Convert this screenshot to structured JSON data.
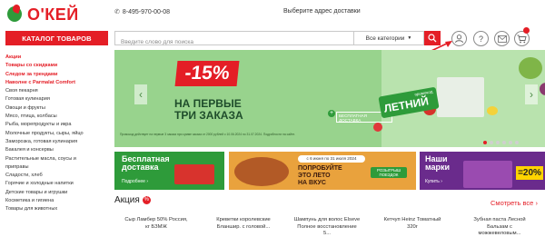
{
  "header": {
    "logo_text": "О'КЕЙ",
    "phone": "8-495-970-00-08",
    "address_prompt": "Выберите адрес доставки"
  },
  "toolbar": {
    "catalog_label": "КАТАЛОГ ТОВАРОВ",
    "search_placeholder": "Введите слово для поиска",
    "category_select": "Все категории",
    "help_symbol": "?"
  },
  "sidebar": {
    "items": [
      {
        "label": "Акции",
        "highlight": true
      },
      {
        "label": "Товары со скидками",
        "highlight": true
      },
      {
        "label": "Следом за трендами",
        "highlight": true
      },
      {
        "label": "Наволне с Parmalat Comfort",
        "highlight": true
      },
      {
        "label": "Своя пекарня",
        "highlight": false
      },
      {
        "label": "Готовая кулинария",
        "highlight": false
      },
      {
        "label": "Овощи и фрукты",
        "highlight": false
      },
      {
        "label": "Мясо, птица, колбасы",
        "highlight": false
      },
      {
        "label": "Рыба, морепродукты и икра",
        "highlight": false
      },
      {
        "label": "Молочные продукты, сыры, яйцо",
        "highlight": false
      },
      {
        "label": "Заморозка, готовая кулинария",
        "highlight": false
      },
      {
        "label": "Бакалея и консервы",
        "highlight": false
      },
      {
        "label": "Растительные масла, соусы и",
        "highlight": false
      },
      {
        "label": "приправы",
        "highlight": false
      },
      {
        "label": "Сладости, хлеб",
        "highlight": false
      },
      {
        "label": "Горячие и холодные напитки",
        "highlight": false
      },
      {
        "label": "Детские товары и игрушки",
        "highlight": false
      },
      {
        "label": "Косметика и гигиена",
        "highlight": false
      },
      {
        "label": "Товары для животных",
        "highlight": false
      }
    ]
  },
  "banner": {
    "discount": "-15%",
    "title_line1": "НА ПЕРВЫЕ",
    "title_line2": "ТРИ ЗАКАЗА",
    "plus": "+",
    "delivery_text": "БЕСПЛАТНАЯ ДОСТАВКА",
    "promo_code_label": "промокод",
    "promo_code": "ЛЕТНИЙ",
    "fine_print": "Промокод действует на первые 3 заказа при сумме заказа от 2000 рублей с 10.06.2024 по 31.07.2024. Подробности на сайте.",
    "prev_arrow": "‹",
    "next_arrow": "›",
    "dots_active": 0,
    "dots_count": 6
  },
  "promos": {
    "mini1_title_1": "Бесплатная",
    "mini1_title_2": "доставка",
    "mini1_link": "Подробнее ›",
    "mini2_date": "с 6 июня по 31 июля 2024",
    "mini2_title_1": "ПОПРОБУЙТЕ",
    "mini2_title_2": "ЭТО ЛЕТО",
    "mini2_title_3": "НА ВКУС",
    "mini2_pill": "РОЗЫГРЫШ ПОЕЗДОК",
    "mini3_title_1": "Наши",
    "mini3_title_2": "марки",
    "mini3_link": "Купить ›",
    "mini3_badge": "=20%"
  },
  "section": {
    "title": "Акция",
    "badge": "%",
    "see_all": "Смотреть все ›"
  },
  "products": [
    {
      "line1": "Сыр Ламбер 50% Россия,",
      "line2": "кг БЗМЖ",
      "line3": ""
    },
    {
      "line1": "Креветки королевские",
      "line2": "Бланшир. с головой...",
      "line3": ""
    },
    {
      "line1": "Шампунь для волос Elseve",
      "line2": "Полное восстановление",
      "line3": "5..."
    },
    {
      "line1": "Кетчуп Heinz Томатный",
      "line2": "320г",
      "line3": ""
    },
    {
      "line1": "Зубная паста Лесной",
      "line2": "Бальзам с",
      "line3": "можжевеловым..."
    }
  ],
  "colors": {
    "brand_red": "#e41e26",
    "brand_green": "#2e9b3a",
    "banner_green": "#98d38d"
  }
}
